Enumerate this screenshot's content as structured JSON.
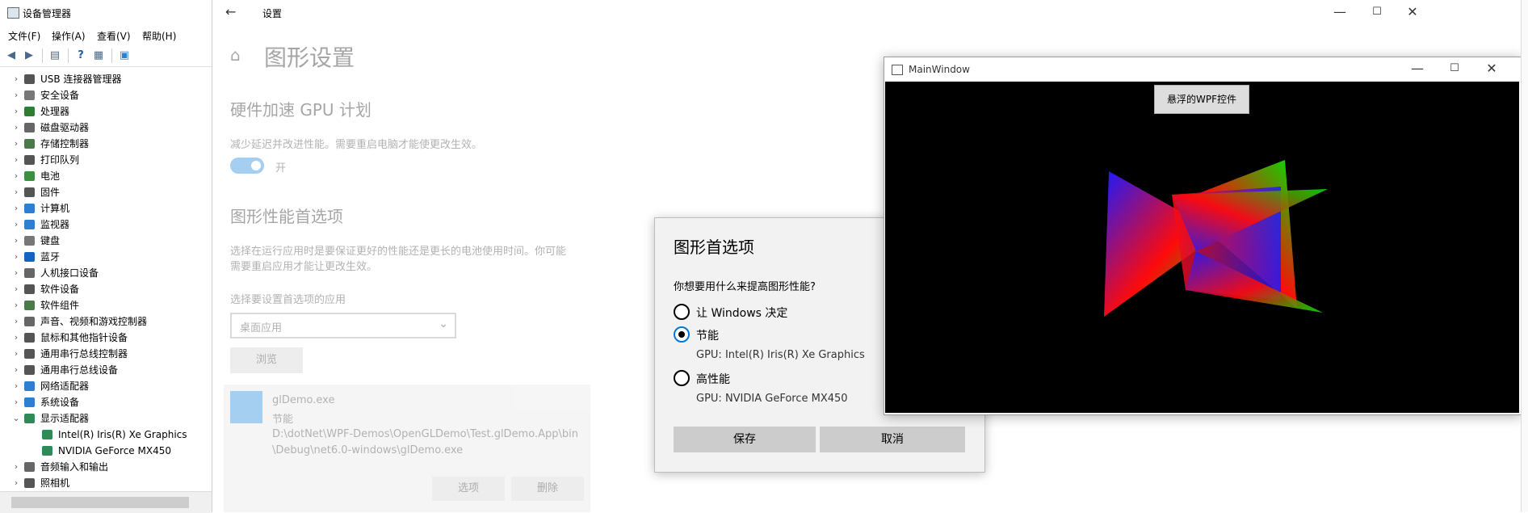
{
  "device_manager": {
    "title": "设备管理器",
    "menu": [
      "文件(F)",
      "操作(A)",
      "查看(V)",
      "帮助(H)"
    ],
    "tree": [
      {
        "label": "USB 连接器管理器",
        "expanded": false,
        "icon": "usb-icon",
        "color": "#555555"
      },
      {
        "label": "安全设备",
        "expanded": false,
        "icon": "security-device-icon",
        "color": "#777777"
      },
      {
        "label": "处理器",
        "expanded": false,
        "icon": "processor-icon",
        "color": "#2f7d32"
      },
      {
        "label": "磁盘驱动器",
        "expanded": false,
        "icon": "disk-drive-icon",
        "color": "#666666"
      },
      {
        "label": "存储控制器",
        "expanded": false,
        "icon": "storage-controller-icon",
        "color": "#4a7a4a"
      },
      {
        "label": "打印队列",
        "expanded": false,
        "icon": "printer-icon",
        "color": "#555555"
      },
      {
        "label": "电池",
        "expanded": false,
        "icon": "battery-icon",
        "color": "#3c8f3c"
      },
      {
        "label": "固件",
        "expanded": false,
        "icon": "firmware-icon",
        "color": "#555555"
      },
      {
        "label": "计算机",
        "expanded": false,
        "icon": "computer-icon",
        "color": "#2e7fd0"
      },
      {
        "label": "监视器",
        "expanded": false,
        "icon": "monitor-icon",
        "color": "#2e7fd0"
      },
      {
        "label": "键盘",
        "expanded": false,
        "icon": "keyboard-icon",
        "color": "#777777"
      },
      {
        "label": "蓝牙",
        "expanded": false,
        "icon": "bluetooth-icon",
        "color": "#1565c0"
      },
      {
        "label": "人机接口设备",
        "expanded": false,
        "icon": "hid-icon",
        "color": "#666666"
      },
      {
        "label": "软件设备",
        "expanded": false,
        "icon": "software-device-icon",
        "color": "#555555"
      },
      {
        "label": "软件组件",
        "expanded": false,
        "icon": "software-component-icon",
        "color": "#4a7a4a"
      },
      {
        "label": "声音、视频和游戏控制器",
        "expanded": false,
        "icon": "sound-icon",
        "color": "#666666"
      },
      {
        "label": "鼠标和其他指针设备",
        "expanded": false,
        "icon": "mouse-icon",
        "color": "#555555"
      },
      {
        "label": "通用串行总线控制器",
        "expanded": false,
        "icon": "usb-controller-icon",
        "color": "#555555"
      },
      {
        "label": "通用串行总线设备",
        "expanded": false,
        "icon": "usb-device-icon",
        "color": "#555555"
      },
      {
        "label": "网络适配器",
        "expanded": false,
        "icon": "network-adapter-icon",
        "color": "#2e7fd0"
      },
      {
        "label": "系统设备",
        "expanded": false,
        "icon": "system-device-icon",
        "color": "#2e7fd0"
      },
      {
        "label": "显示适配器",
        "expanded": true,
        "icon": "display-adapter-icon",
        "color": "#2e8b57"
      },
      {
        "label": "Intel(R) Iris(R) Xe Graphics",
        "child": true,
        "icon": "display-adapter-icon",
        "color": "#2e8b57"
      },
      {
        "label": "NVIDIA GeForce MX450",
        "child": true,
        "icon": "display-adapter-icon",
        "color": "#2e8b57"
      },
      {
        "label": "音频输入和输出",
        "expanded": false,
        "icon": "audio-icon",
        "color": "#666666"
      },
      {
        "label": "照相机",
        "expanded": false,
        "icon": "camera-icon",
        "color": "#555555"
      }
    ]
  },
  "settings": {
    "window_title": "设置",
    "page_title": "图形设置",
    "gpu_section_title": "硬件加速 GPU 计划",
    "gpu_desc": "减少延迟并改进性能。需要重启电脑才能使更改生效。",
    "toggle_label": "开",
    "pref_title": "图形性能首选项",
    "pref_desc_line1": "选择在运行应用时是要保证更好的性能还是更长的电池使用时间。你可能",
    "pref_desc_line2": "需要重启应用才能让更改生效。",
    "choose_label": "选择要设置首选项的应用",
    "dropdown_value": "桌面应用",
    "browse_label": "浏览",
    "app": {
      "name": "glDemo.exe",
      "mode": "节能",
      "path_line1": "D:\\dotNet\\WPF-Demos\\OpenGLDemo\\Test.glDemo.App\\bin",
      "path_line2": "\\Debug\\net6.0-windows\\glDemo.exe"
    },
    "options_label": "选项",
    "delete_label": "删除"
  },
  "dialog": {
    "title": "图形首选项",
    "question": "你想要用什么来提高图形性能?",
    "options": [
      {
        "label": "让 Windows 决定",
        "sub": "",
        "selected": false
      },
      {
        "label": "节能",
        "sub": "GPU: Intel(R) Iris(R) Xe Graphics",
        "selected": true
      },
      {
        "label": "高性能",
        "sub": "GPU: NVIDIA GeForce MX450",
        "selected": false
      }
    ],
    "save_label": "保存",
    "cancel_label": "取消"
  },
  "main_window": {
    "title": "MainWindow",
    "floating_button": "悬浮的WPF控件"
  },
  "colors": {
    "accent": "#0078d7"
  }
}
